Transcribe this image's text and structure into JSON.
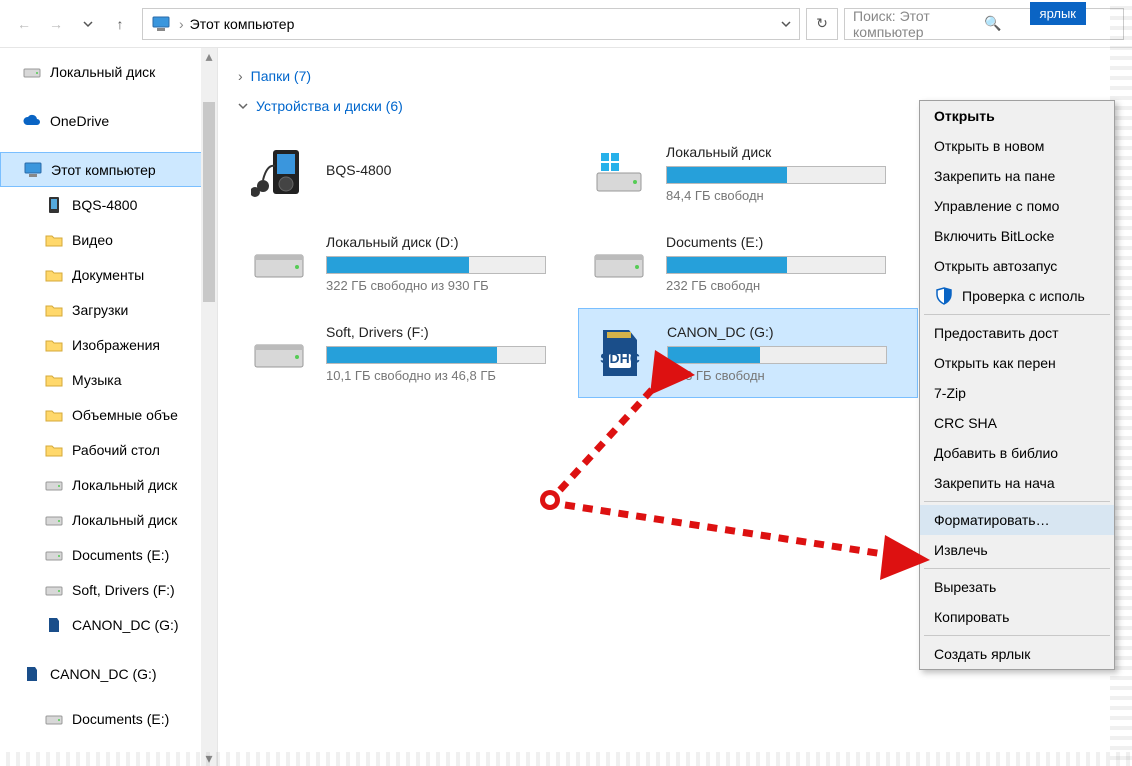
{
  "toolbar": {
    "location": "Этот компьютер",
    "search_placeholder": "Поиск: Этот компьютер"
  },
  "external": {
    "yarlyk": "ярлык"
  },
  "sidebar": {
    "items": [
      {
        "label": "Локальный диск",
        "icon": "drive"
      },
      {
        "label": "OneDrive",
        "icon": "cloud"
      },
      {
        "label": "Этот компьютер",
        "icon": "pc",
        "selected": true
      },
      {
        "label": "BQS-4800",
        "icon": "phone",
        "l2": true
      },
      {
        "label": "Видео",
        "icon": "folder",
        "l2": true
      },
      {
        "label": "Документы",
        "icon": "folder",
        "l2": true
      },
      {
        "label": "Загрузки",
        "icon": "folder",
        "l2": true
      },
      {
        "label": "Изображения",
        "icon": "folder",
        "l2": true
      },
      {
        "label": "Музыка",
        "icon": "folder",
        "l2": true
      },
      {
        "label": "Объемные объе",
        "icon": "folder",
        "l2": true
      },
      {
        "label": "Рабочий стол",
        "icon": "folder",
        "l2": true
      },
      {
        "label": "Локальный диск",
        "icon": "drive",
        "l2": true
      },
      {
        "label": "Локальный диск",
        "icon": "drive",
        "l2": true
      },
      {
        "label": "Documents (E:)",
        "icon": "drive",
        "l2": true
      },
      {
        "label": "Soft, Drivers (F:)",
        "icon": "drive",
        "l2": true
      },
      {
        "label": "CANON_DC (G:)",
        "icon": "sd",
        "l2": true
      },
      {
        "label": "CANON_DC (G:)",
        "icon": "sd"
      },
      {
        "label": "Documents (E:)",
        "icon": "drive",
        "l2": true
      }
    ]
  },
  "main": {
    "section_folders": "Папки (7)",
    "section_drives": "Устройства и диски (6)",
    "drives": [
      {
        "name": "BQS-4800",
        "icon": "mp3",
        "free": "",
        "pct": 0
      },
      {
        "name": "Локальный диск",
        "icon": "os",
        "free": "84,4 ГБ свободн",
        "pct": 55
      },
      {
        "name": "Локальный диск (D:)",
        "icon": "hdd",
        "free": "322 ГБ свободно из 930 ГБ",
        "pct": 65
      },
      {
        "name": "Documents (E:)",
        "icon": "hdd",
        "free": "232 ГБ свободн",
        "pct": 55
      },
      {
        "name": "Soft, Drivers (F:)",
        "icon": "hdd",
        "free": "10,1 ГБ свободно из 46,8 ГБ",
        "pct": 78
      },
      {
        "name": "CANON_DC (G:)",
        "icon": "sdhc",
        "free": "4,33 ГБ свободн",
        "pct": 42,
        "selected": true
      }
    ]
  },
  "context": {
    "items": [
      {
        "label": "Открыть",
        "bold": true
      },
      {
        "label": "Открыть в новом "
      },
      {
        "label": "Закрепить на пане"
      },
      {
        "label": "Управление с помо"
      },
      {
        "label": "Включить BitLocke"
      },
      {
        "label": "Открыть автозапус"
      },
      {
        "label": "Проверка с исполь",
        "icon": "shield"
      },
      {
        "sep": true
      },
      {
        "label": "Предоставить дост"
      },
      {
        "label": "Открыть как перен"
      },
      {
        "label": "7-Zip"
      },
      {
        "label": "CRC SHA"
      },
      {
        "label": "Добавить в библио"
      },
      {
        "label": "Закрепить на нача"
      },
      {
        "sep": true
      },
      {
        "label": "Форматировать…",
        "hl": true
      },
      {
        "label": "Извлечь"
      },
      {
        "sep": true
      },
      {
        "label": "Вырезать"
      },
      {
        "label": "Копировать"
      },
      {
        "sep": true
      },
      {
        "label": "Создать ярлык"
      }
    ]
  }
}
